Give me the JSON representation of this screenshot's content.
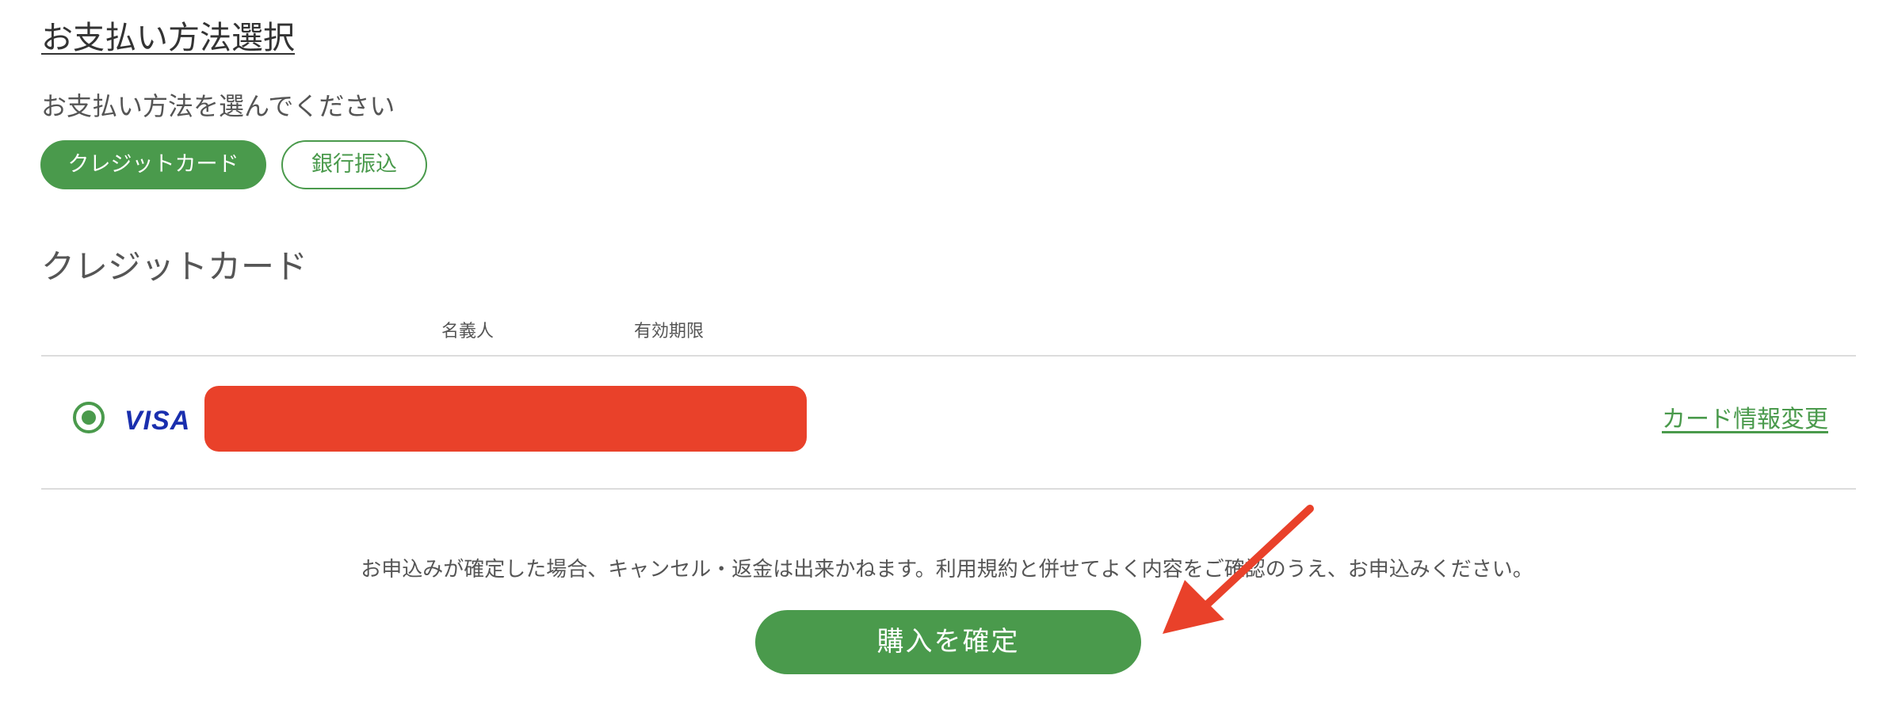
{
  "page": {
    "title": "お支払い方法選択",
    "subtitle": "お支払い方法を選んでください"
  },
  "payment_methods": [
    {
      "label": "クレジットカード",
      "selected": true
    },
    {
      "label": "銀行振込",
      "selected": false
    }
  ],
  "credit_card_section": {
    "title": "クレジットカード",
    "columns": {
      "holder": "名義人",
      "expiry": "有効期限"
    },
    "card": {
      "brand": "VISA",
      "selected": true,
      "details_redacted": true,
      "change_link": "カード情報変更"
    }
  },
  "notice": "お申込みが確定した場合、キャンセル・返金は出来かねます。利用規約と併せてよく内容をご確認のうえ、お申込みください。",
  "confirm_button": "購入を確定",
  "colors": {
    "accent_green": "#4a9a4c",
    "title_highlight": "#f4e44b",
    "annotation_red": "#e9412a",
    "visa_blue": "#1a2fae"
  },
  "icons": {
    "radio": "radio-selected-icon",
    "annotation": "arrow-pointer-icon"
  }
}
